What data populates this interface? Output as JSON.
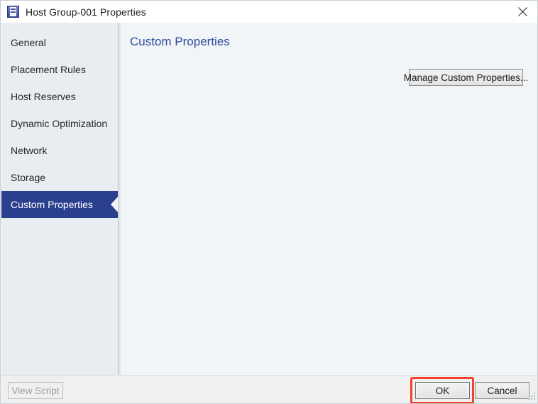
{
  "window": {
    "title": "Host Group-001 Properties",
    "icon": "host-group-icon",
    "close_icon": "close-icon",
    "accent_selected": "#2b3f8f",
    "heading_color": "#2e4a9e",
    "highlight_color": "#f5402c"
  },
  "sidebar": {
    "items": [
      {
        "label": "General",
        "selected": false
      },
      {
        "label": "Placement Rules",
        "selected": false
      },
      {
        "label": "Host Reserves",
        "selected": false
      },
      {
        "label": "Dynamic Optimization",
        "selected": false
      },
      {
        "label": "Network",
        "selected": false
      },
      {
        "label": "Storage",
        "selected": false
      },
      {
        "label": "Custom Properties",
        "selected": true
      }
    ]
  },
  "content": {
    "heading": "Custom Properties",
    "manage_button": "Manage Custom Properties..."
  },
  "footer": {
    "view_script": "View Script",
    "view_script_enabled": false,
    "ok": "OK",
    "cancel": "Cancel",
    "ok_highlighted": true
  }
}
